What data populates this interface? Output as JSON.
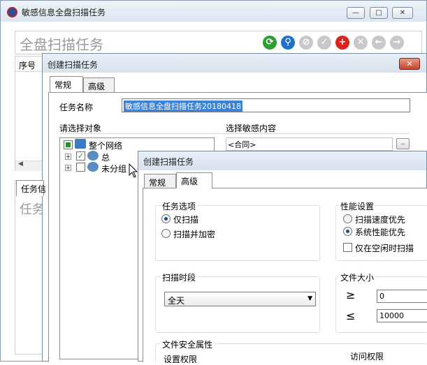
{
  "main": {
    "title": "敏感信息全盘扫描任务",
    "heading": "全盘扫描任务",
    "col_seq": "序号",
    "tab_task": "任务信",
    "lower_heading": "任务"
  },
  "dialog1": {
    "title": "创建扫描任务",
    "tabs": [
      "常规",
      "高级"
    ],
    "task_name_label": "任务名称",
    "task_name_value": "敏感信息全盘扫描任务20180418",
    "select_object_label": "请选择对象",
    "select_content_label": "选择敏感内容",
    "content_value": "<合同>",
    "browse_label": "..",
    "tree": {
      "root": "整个网络",
      "child1": "总",
      "child2": "未分组"
    }
  },
  "dialog2": {
    "title": "创建扫描任务",
    "tabs": [
      "常规",
      "高级"
    ],
    "task_options": {
      "title": "任务选项",
      "opt1": "仅扫描",
      "opt2": "扫描并加密"
    },
    "performance": {
      "title": "性能设置",
      "opt1": "扫描速度优先",
      "opt2": "系统性能优先",
      "idle_label": "仅在空闲时扫描"
    },
    "period": {
      "title": "扫描时段",
      "value": "全天"
    },
    "file_size": {
      "title": "文件大小",
      "ge_symbol": "≥",
      "ge_value": "0",
      "le_symbol": "≤",
      "le_value": "10000"
    },
    "security": {
      "title": "文件安全属性",
      "perm_label": "设置权限",
      "access_label": "访问权限"
    }
  }
}
